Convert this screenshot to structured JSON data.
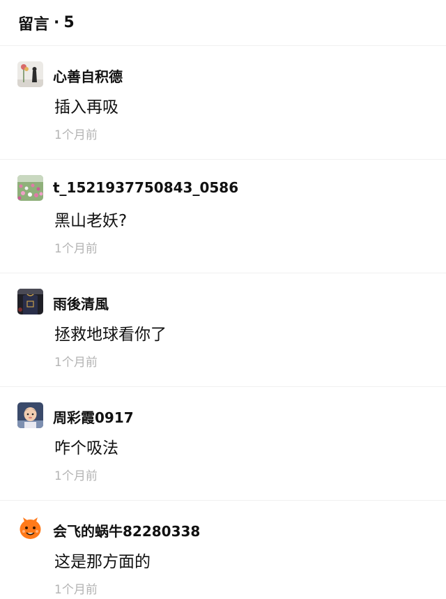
{
  "header": {
    "title": "留言",
    "separator": "·",
    "count": "5"
  },
  "comments": [
    {
      "username": "心善自积德",
      "content": "插入再吸",
      "time": "1个月前",
      "avatar_icon": "flower-vase-avatar"
    },
    {
      "username": "t_1521937750843_0586",
      "content": "黑山老妖?",
      "time": "1个月前",
      "avatar_icon": "flower-field-avatar"
    },
    {
      "username": "雨後清風",
      "content": "拯救地球看你了",
      "time": "1个月前",
      "avatar_icon": "basketball-jersey-avatar"
    },
    {
      "username": "周彩霞0917",
      "content": "咋个吸法",
      "time": "1个月前",
      "avatar_icon": "baby-photo-avatar"
    },
    {
      "username": "会飞的蜗牛82280338",
      "content": "这是那方面的",
      "time": "1个月前",
      "avatar_icon": "orange-cartoon-avatar"
    }
  ]
}
